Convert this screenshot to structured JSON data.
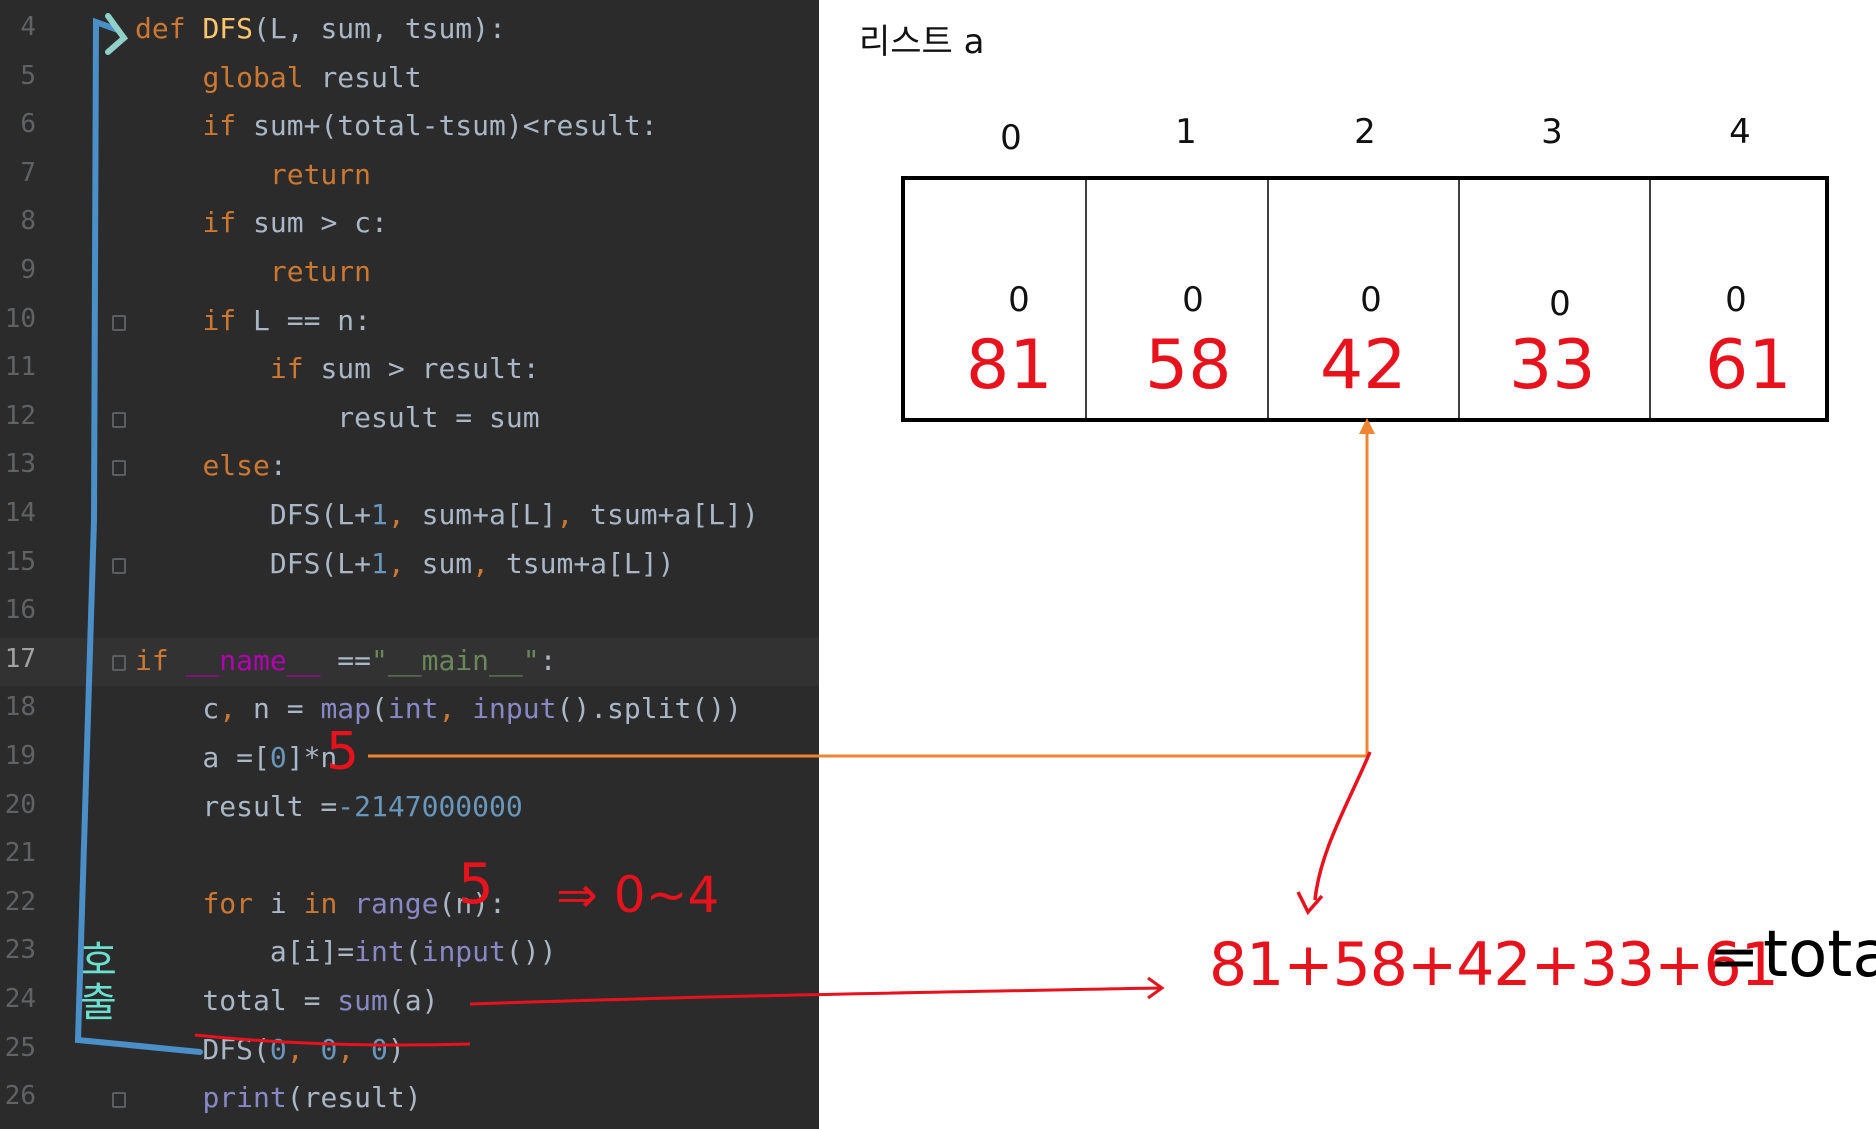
{
  "editor": {
    "lines": [
      {
        "num": "4",
        "tokens": [
          [
            "kw",
            "def "
          ],
          [
            "fn",
            "DFS"
          ],
          [
            "",
            "(L, sum, tsum):"
          ]
        ]
      },
      {
        "num": "5",
        "tokens": [
          [
            "",
            "    "
          ],
          [
            "kw",
            "global "
          ],
          [
            "",
            "result"
          ]
        ]
      },
      {
        "num": "6",
        "tokens": [
          [
            "",
            "    "
          ],
          [
            "kw",
            "if "
          ],
          [
            "",
            "sum+(total-tsum)<result:"
          ]
        ]
      },
      {
        "num": "7",
        "tokens": [
          [
            "",
            "        "
          ],
          [
            "kw",
            "return"
          ]
        ]
      },
      {
        "num": "8",
        "tokens": [
          [
            "",
            "    "
          ],
          [
            "kw",
            "if "
          ],
          [
            "",
            "sum > c:"
          ]
        ]
      },
      {
        "num": "9",
        "tokens": [
          [
            "",
            "        "
          ],
          [
            "kw",
            "return"
          ]
        ]
      },
      {
        "num": "10",
        "tokens": [
          [
            "",
            "    "
          ],
          [
            "kw",
            "if "
          ],
          [
            "",
            "L == n:"
          ]
        ]
      },
      {
        "num": "11",
        "tokens": [
          [
            "",
            "        "
          ],
          [
            "kw",
            "if "
          ],
          [
            "",
            "sum > result:"
          ]
        ]
      },
      {
        "num": "12",
        "tokens": [
          [
            "",
            "            result = sum"
          ]
        ]
      },
      {
        "num": "13",
        "tokens": [
          [
            "",
            "    "
          ],
          [
            "kw",
            "else"
          ],
          [
            "",
            ":"
          ]
        ]
      },
      {
        "num": "14",
        "tokens": [
          [
            "",
            "        DFS(L+"
          ],
          [
            "num",
            "1"
          ],
          [
            "kw",
            ", "
          ],
          [
            "",
            "sum+a[L]"
          ],
          [
            "kw",
            ", "
          ],
          [
            "",
            "tsum+a[L])"
          ]
        ]
      },
      {
        "num": "15",
        "tokens": [
          [
            "",
            "        DFS(L+"
          ],
          [
            "num",
            "1"
          ],
          [
            "kw",
            ", "
          ],
          [
            "",
            "sum"
          ],
          [
            "kw",
            ", "
          ],
          [
            "",
            "tsum+a[L])"
          ]
        ]
      },
      {
        "num": "16",
        "tokens": []
      },
      {
        "num": "17",
        "tokens": [
          [
            "kw",
            "if "
          ],
          [
            "dunder",
            "__name__"
          ],
          [
            "",
            " =="
          ],
          [
            "str",
            "\"__main__\""
          ],
          [
            "",
            ":"
          ]
        ]
      },
      {
        "num": "18",
        "tokens": [
          [
            "",
            "    c"
          ],
          [
            "kw",
            ", "
          ],
          [
            "",
            "n = "
          ],
          [
            "bi",
            "map"
          ],
          [
            "",
            "("
          ],
          [
            "bi",
            "int"
          ],
          [
            "kw",
            ", "
          ],
          [
            "bi",
            "input"
          ],
          [
            "",
            "().split())"
          ]
        ]
      },
      {
        "num": "19",
        "tokens": [
          [
            "",
            "    a =["
          ],
          [
            "num",
            "0"
          ],
          [
            "",
            "]*n"
          ]
        ]
      },
      {
        "num": "20",
        "tokens": [
          [
            "",
            "    result ="
          ],
          [
            "num",
            "-2147000000"
          ]
        ]
      },
      {
        "num": "21",
        "tokens": []
      },
      {
        "num": "22",
        "tokens": [
          [
            "",
            "    "
          ],
          [
            "kw",
            "for "
          ],
          [
            "",
            "i "
          ],
          [
            "kw",
            "in "
          ],
          [
            "bi",
            "range"
          ],
          [
            "",
            "(n):"
          ]
        ]
      },
      {
        "num": "23",
        "tokens": [
          [
            "",
            "        a[i]="
          ],
          [
            "bi",
            "int"
          ],
          [
            "",
            "("
          ],
          [
            "bi",
            "input"
          ],
          [
            "",
            "())"
          ]
        ]
      },
      {
        "num": "24",
        "tokens": [
          [
            "",
            "    total = "
          ],
          [
            "bi",
            "sum"
          ],
          [
            "",
            "(a)"
          ]
        ]
      },
      {
        "num": "25",
        "tokens": [
          [
            "",
            "    DFS("
          ],
          [
            "num",
            "0"
          ],
          [
            "kw",
            ", "
          ],
          [
            "num",
            "0"
          ],
          [
            "kw",
            ", "
          ],
          [
            "num",
            "0"
          ],
          [
            "",
            ")"
          ]
        ]
      },
      {
        "num": "26",
        "tokens": [
          [
            "",
            "    "
          ],
          [
            "bi",
            "print"
          ],
          [
            "",
            "(result)"
          ]
        ]
      }
    ]
  },
  "diagram": {
    "title": "리스트 a",
    "indices": [
      "0",
      "1",
      "2",
      "3",
      "4"
    ],
    "initial_values": [
      "0",
      "0",
      "0",
      "0",
      "0"
    ],
    "filled_values": [
      "81",
      "58",
      "42",
      "33",
      "61"
    ],
    "annotations": {
      "n_value": "5",
      "range_value": "5",
      "range_result": "⇒ 0~4",
      "sum_expr": "81+58+42+33+61",
      "equals": "=",
      "total_word": "total",
      "call_label": "호출"
    }
  },
  "colors": {
    "editor_bg": "#2b2b2b",
    "handwriting_red": "#e8121d",
    "arrow_orange": "#ef8433",
    "keyword": "#cc7832"
  }
}
